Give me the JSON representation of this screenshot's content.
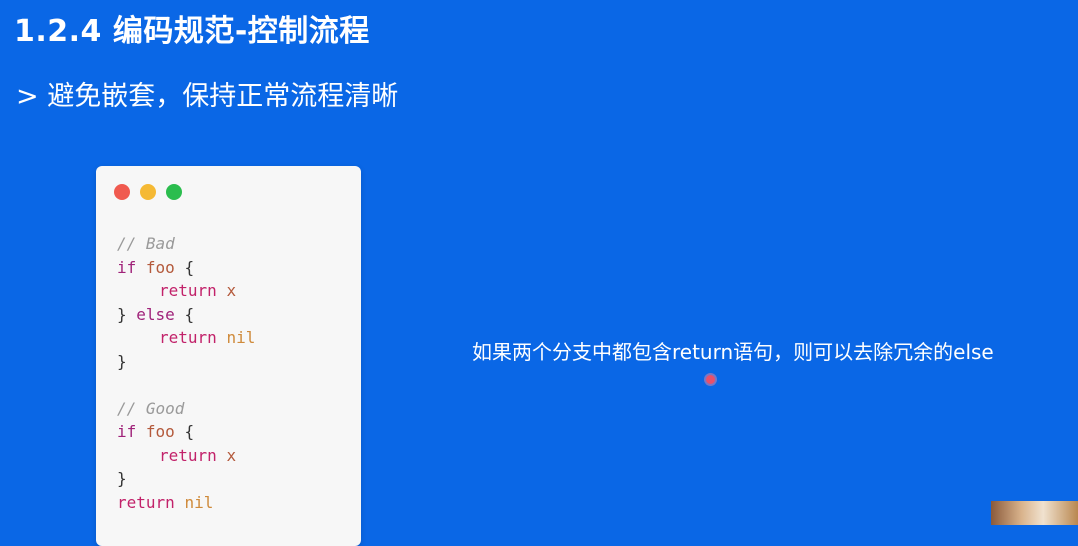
{
  "slide": {
    "title": "1.2.4 编码规范-控制流程",
    "subtitle": "> 避免嵌套，保持正常流程清晰",
    "note": "如果两个分支中都包含return语句，则可以去除冗余的else"
  },
  "code": {
    "bad_comment": "// Bad",
    "good_comment": "// Good",
    "kw_if": "if",
    "kw_else": "else",
    "kw_return": "return",
    "ident_foo": "foo",
    "ident_x": "x",
    "ident_nil": "nil",
    "open_brace": "{",
    "close_brace": "}",
    "close_else_open": "} ",
    "space": " "
  },
  "colors": {
    "background": "#0a67e6",
    "card": "#f7f7f7",
    "dot_red": "#f05a4f",
    "dot_yellow": "#f5b934",
    "dot_green": "#2bbd4e",
    "comment": "#9a9a9a",
    "keyword": "#a0237a",
    "nil": "#cf8a3a"
  }
}
